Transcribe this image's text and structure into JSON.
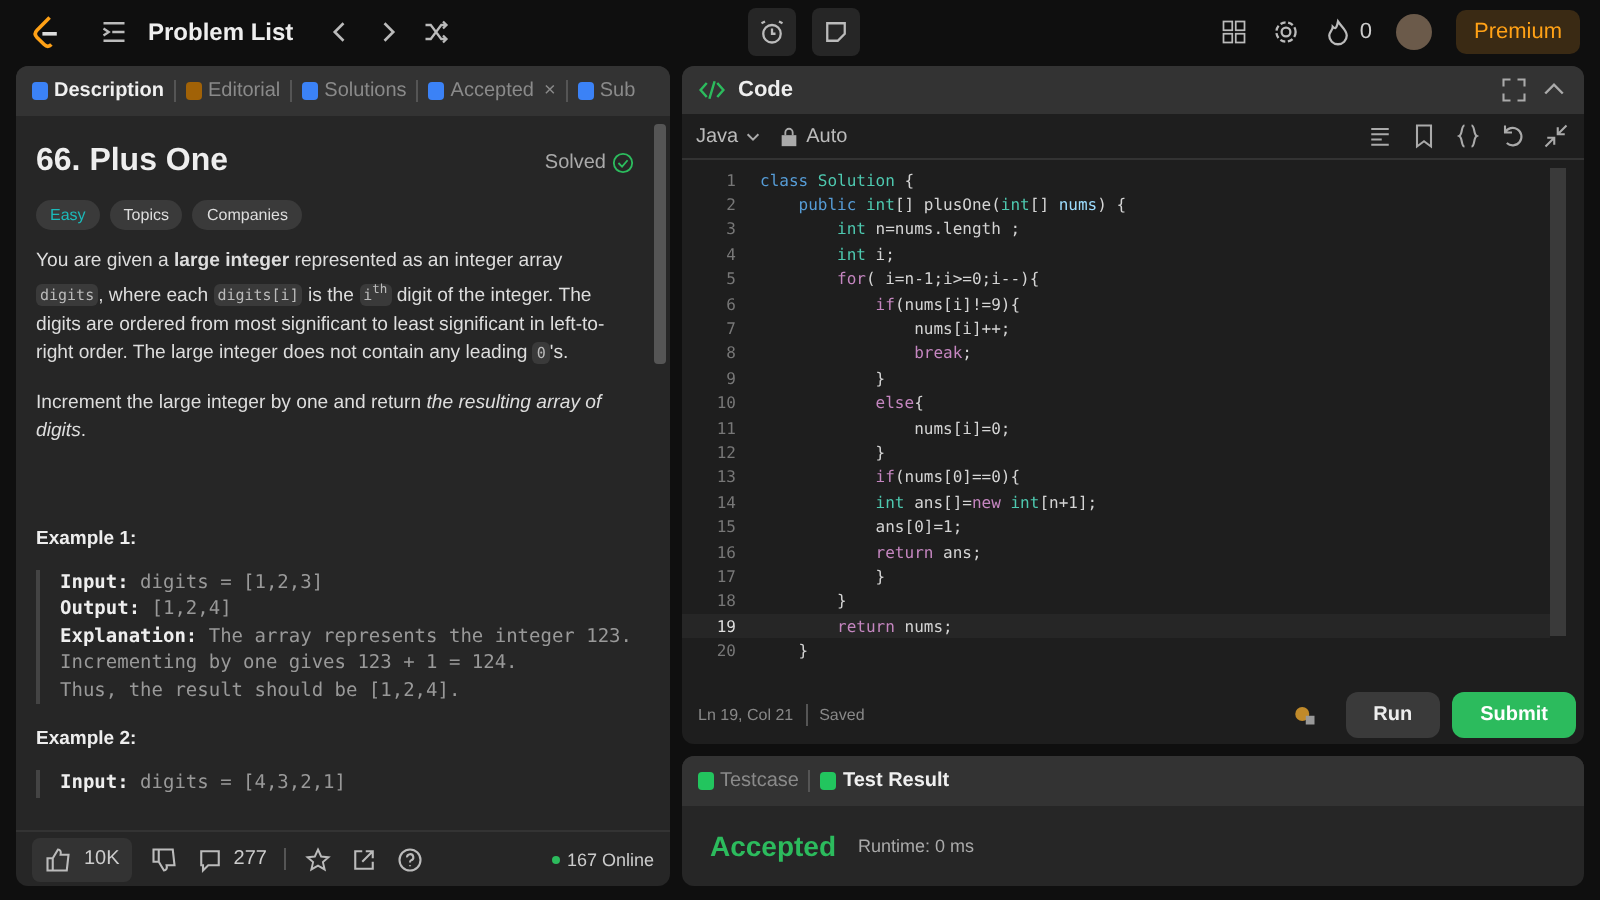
{
  "topbar": {
    "title": "Problem List",
    "streak": "0",
    "premium": "Premium"
  },
  "left_tabs": [
    {
      "label": "Description",
      "selected": true
    },
    {
      "label": "Editorial",
      "selected": false
    },
    {
      "label": "Solutions",
      "selected": false
    },
    {
      "label": "Accepted",
      "selected": false,
      "close": "×"
    },
    {
      "label": "Sub",
      "selected": false
    }
  ],
  "problem": {
    "title": "66. Plus One",
    "status": "Solved",
    "difficulty": "Easy",
    "tags": [
      "Topics",
      "Companies"
    ],
    "paragraphs": [
      [
        {
          "kind": "text",
          "t": "You are given a **large integer** represented as an integer array "
        },
        {
          "kind": "code",
          "t": "digits"
        },
        {
          "kind": "text",
          "t": ", where each "
        },
        {
          "kind": "code",
          "t": "digits[i]"
        },
        {
          "kind": "text",
          "t": " is the "
        },
        {
          "kind": "code",
          "t": "i$^{th}$"
        },
        {
          "kind": "text",
          "t": " digit of the integer. The digits are ordered from most significant to least significant in left-to-right order. The large integer does not contain any leading "
        },
        {
          "kind": "code",
          "t": "0"
        },
        {
          "kind": "text",
          "t": "'s."
        }
      ],
      [
        {
          "kind": "text",
          "t": "Increment the large integer by one and return *the resulting array of digits*."
        }
      ]
    ],
    "examples": [
      {
        "title": "Example 1:",
        "lines": [
          "**Input:** digits = [1,2,3]",
          "**Output:** [1,2,4]",
          "**Explanation:** The array represents the integer 123.",
          "Incrementing by one gives 123 + 1 = 124.",
          "Thus, the result should be [1,2,4]."
        ]
      },
      {
        "title": "Example 2:",
        "lines": [
          "**Input:** digits = [4,3,2,1]"
        ]
      }
    ]
  },
  "footer": {
    "likes": "10K",
    "comments": "277",
    "online": "167 Online"
  },
  "code_panel": {
    "title": "Code",
    "language": "Java",
    "mode": "Auto",
    "cursor": "Ln 19, Col 21",
    "saved": "Saved",
    "run": "Run",
    "submit": "Submit",
    "lines": [
      {
        "number": "1",
        "current": false,
        "tokens": [
          {
            "kind": "keyword",
            "t": "class "
          },
          {
            "kind": "type",
            "t": "Solution"
          },
          {
            "kind": "plain",
            "t": " {"
          }
        ]
      },
      {
        "number": "2",
        "current": false,
        "tokens": [
          {
            "kind": "keyword",
            "t": "    public "
          },
          {
            "kind": "type",
            "t": "int"
          },
          {
            "kind": "plain",
            "t": "[] plusOne("
          },
          {
            "kind": "type",
            "t": "int"
          },
          {
            "kind": "plain",
            "t": "[] "
          },
          {
            "kind": "variable",
            "t": "nums"
          },
          {
            "kind": "plain",
            "t": ") {"
          }
        ]
      },
      {
        "number": "3",
        "current": false,
        "tokens": [
          {
            "kind": "type",
            "t": "        int"
          },
          {
            "kind": "plain",
            "t": " n=nums.length ;"
          }
        ]
      },
      {
        "number": "4",
        "current": false,
        "tokens": [
          {
            "kind": "type",
            "t": "        int"
          },
          {
            "kind": "plain",
            "t": " i;"
          }
        ]
      },
      {
        "number": "5",
        "current": false,
        "tokens": [
          {
            "kind": "control",
            "t": "        for"
          },
          {
            "kind": "plain",
            "t": "( i=n-1;i>=0;i--){"
          }
        ]
      },
      {
        "number": "6",
        "current": false,
        "tokens": [
          {
            "kind": "control",
            "t": "            if"
          },
          {
            "kind": "plain",
            "t": "(nums[i]!=9){"
          }
        ]
      },
      {
        "number": "7",
        "current": false,
        "tokens": [
          {
            "kind": "plain",
            "t": "                nums[i]++;"
          }
        ]
      },
      {
        "number": "8",
        "current": false,
        "tokens": [
          {
            "kind": "control",
            "t": "                break"
          },
          {
            "kind": "plain",
            "t": ";"
          }
        ]
      },
      {
        "number": "9",
        "current": false,
        "tokens": [
          {
            "kind": "plain",
            "t": "            }"
          }
        ]
      },
      {
        "number": "10",
        "current": false,
        "tokens": [
          {
            "kind": "control",
            "t": "            else"
          },
          {
            "kind": "plain",
            "t": "{"
          }
        ]
      },
      {
        "number": "11",
        "current": false,
        "tokens": [
          {
            "kind": "plain",
            "t": "                nums[i]=0;"
          }
        ]
      },
      {
        "number": "12",
        "current": false,
        "tokens": [
          {
            "kind": "plain",
            "t": "            }"
          }
        ]
      },
      {
        "number": "13",
        "current": false,
        "tokens": [
          {
            "kind": "control",
            "t": "            if"
          },
          {
            "kind": "plain",
            "t": "(nums[0]==0){"
          }
        ]
      },
      {
        "number": "14",
        "current": false,
        "tokens": [
          {
            "kind": "type",
            "t": "            int"
          },
          {
            "kind": "plain",
            "t": " ans[]="
          },
          {
            "kind": "control",
            "t": "new "
          },
          {
            "kind": "type",
            "t": "int"
          },
          {
            "kind": "plain",
            "t": "[n+1];"
          }
        ]
      },
      {
        "number": "15",
        "current": false,
        "tokens": [
          {
            "kind": "plain",
            "t": "            ans[0]=1;"
          }
        ]
      },
      {
        "number": "16",
        "current": false,
        "tokens": [
          {
            "kind": "control",
            "t": "            return"
          },
          {
            "kind": "plain",
            "t": " ans;"
          }
        ]
      },
      {
        "number": "17",
        "current": false,
        "tokens": [
          {
            "kind": "plain",
            "t": "            }"
          }
        ]
      },
      {
        "number": "18",
        "current": false,
        "tokens": [
          {
            "kind": "plain",
            "t": "        }"
          }
        ]
      },
      {
        "number": "19",
        "current": true,
        "tokens": [
          {
            "kind": "control",
            "t": "        return"
          },
          {
            "kind": "plain",
            "t": " nums;"
          }
        ]
      },
      {
        "number": "20",
        "current": false,
        "tokens": [
          {
            "kind": "plain",
            "t": "    }"
          }
        ]
      }
    ]
  },
  "result_tabs": [
    {
      "label": "Testcase",
      "selected": false
    },
    {
      "label": "Test Result",
      "selected": true
    }
  ],
  "result": {
    "verdict": "Accepted",
    "runtime": "Runtime: 0 ms"
  }
}
